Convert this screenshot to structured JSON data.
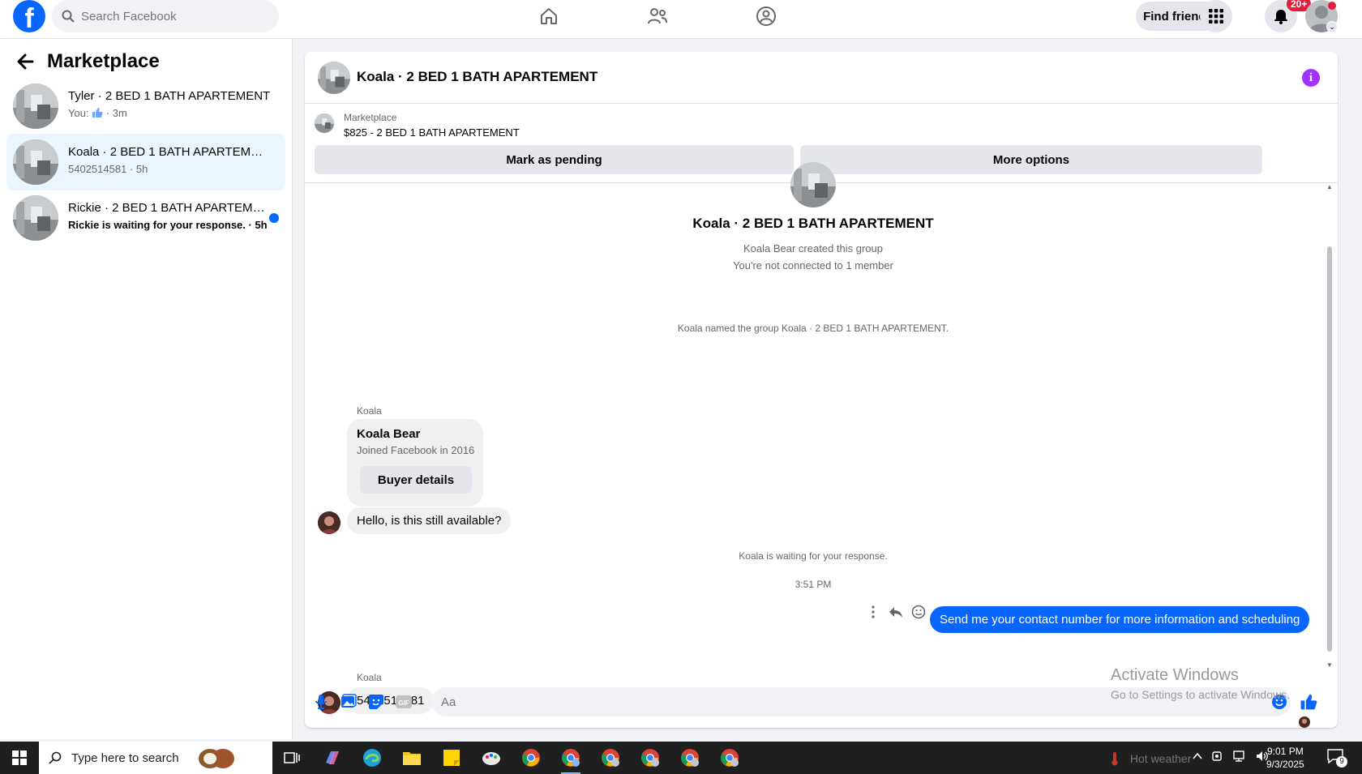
{
  "topbar": {
    "logo_letter": "f",
    "search_placeholder": "Search Facebook",
    "find_friends_label": "Find friends",
    "notification_badge": "20+"
  },
  "sidebar": {
    "title": "Marketplace",
    "conversations": [
      {
        "title": "Tyler · 2 BED 1 BATH APARTEMENT",
        "subtitle_prefix": "You:",
        "subtitle_suffix": "· 3m",
        "unread": false,
        "active": false
      },
      {
        "title": "Koala · 2 BED 1 BATH APARTEMENT",
        "subtitle": "5402514581 · 5h",
        "unread": false,
        "active": true
      },
      {
        "title": "Rickie · 2 BED 1 BATH APARTEME...",
        "subtitle": "Rickie is waiting for your response. · 5h",
        "unread": true,
        "active": false
      }
    ]
  },
  "chat": {
    "header_title": "Koala · 2 BED 1 BATH APARTEMENT",
    "marketplace_label": "Marketplace",
    "listing": "$825 - 2 BED 1 BATH APARTEMENT",
    "mark_pending_label": "Mark as pending",
    "more_options_label": "More options",
    "group_title": "Koala · 2 BED 1 BATH APARTEMENT",
    "created_text": "Koala Bear created this group",
    "connection_text": "You're not connected to 1 member",
    "named_text": "Koala named the group Koala · 2 BED 1 BATH APARTEMENT.",
    "card": {
      "sender": "Koala",
      "name": "Koala Bear",
      "joined": "Joined Facebook in 2016",
      "button": "Buyer details"
    },
    "messages": [
      {
        "direction": "in",
        "text": "Hello, is this still available?"
      },
      {
        "direction": "out",
        "text": "Send me your contact number for more information and  scheduling"
      },
      {
        "direction": "in",
        "sender": "Koala",
        "text": "5402514581"
      }
    ],
    "waiting_text": "Koala is waiting for your response.",
    "timestamp": "3:51 PM",
    "composer_placeholder": "Aa"
  },
  "watermark": {
    "title": "Activate Windows",
    "subtitle": "Go to Settings to activate Windows."
  },
  "taskbar": {
    "search_placeholder": "Type here to search",
    "weather": "Hot weather",
    "time": "9:01 PM",
    "date": "9/3/2025",
    "notification_count": "9"
  },
  "colors": {
    "brand": "#0866ff",
    "active_conversation": "#ebf5ff",
    "outgoing_bubble": "#0866ff",
    "info_icon": "#a033ff",
    "badge": "#e41e3f"
  }
}
